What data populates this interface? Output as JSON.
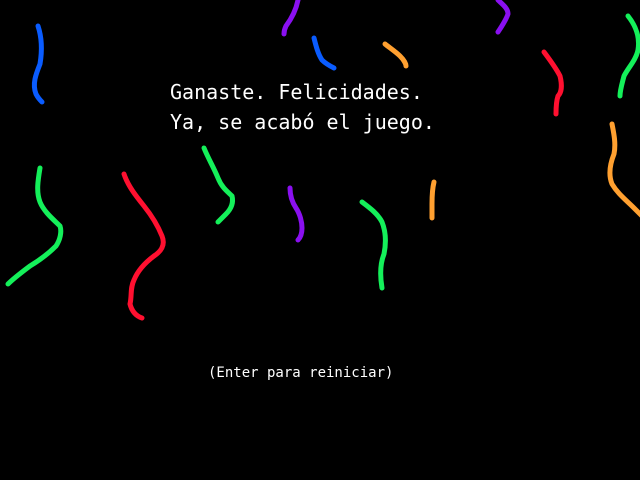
{
  "message": {
    "line1": "Ganaste. Felicidades.",
    "line2": "Ya, se acabó el juego."
  },
  "restart_hint": "(Enter para reiniciar)",
  "colors": {
    "background": "#000000",
    "text": "#ffffff",
    "confetti": {
      "blue": "#0a5cff",
      "purple": "#8a10f0",
      "green": "#14f05a",
      "red": "#ff1030",
      "orange": "#ffa030"
    }
  },
  "confetti_colors": [
    "blue",
    "purple",
    "blue",
    "orange",
    "purple",
    "red",
    "green",
    "green",
    "red",
    "green",
    "purple",
    "green",
    "orange",
    "orange"
  ]
}
